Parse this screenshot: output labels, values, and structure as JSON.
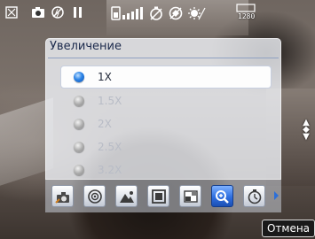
{
  "status_bar": {
    "icons": [
      "resize-icon",
      "camera-mode-icon",
      "flash-off-icon",
      "pause-icon",
      "battery-icon",
      "timer-off-icon",
      "stabilizer-off-icon",
      "white-balance-icon"
    ],
    "resolution_label": "1280"
  },
  "zoom_panel": {
    "title": "Увеличение",
    "options": [
      {
        "label": "1X",
        "selected": true,
        "enabled": true
      },
      {
        "label": "1.5X",
        "selected": false,
        "enabled": false
      },
      {
        "label": "2X",
        "selected": false,
        "enabled": false
      },
      {
        "label": "2.5X",
        "selected": false,
        "enabled": false
      },
      {
        "label": "3.2X",
        "selected": false,
        "enabled": false
      }
    ]
  },
  "toolbar": {
    "buttons": [
      "camera-settings-icon",
      "metering-icon",
      "scene-icon",
      "frame-icon",
      "quality-icon",
      "zoom-icon",
      "timer-icon"
    ],
    "active_button": "zoom-icon"
  },
  "softkey": {
    "cancel_label": "Отмена"
  },
  "colors": {
    "accent": "#2c83e6",
    "panel_title": "#1c2a4c"
  }
}
